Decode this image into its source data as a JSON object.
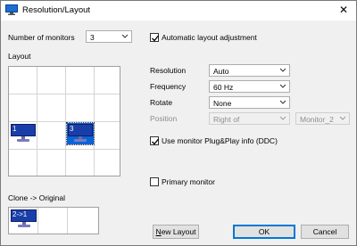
{
  "window": {
    "title": "Resolution/Layout",
    "close_glyph": "✕"
  },
  "monitors_count": {
    "label": "Number of monitors",
    "value": "3"
  },
  "auto_layout": {
    "label": "Automatic layout adjustment",
    "checked": true
  },
  "layout": {
    "label": "Layout",
    "monitors": [
      {
        "number": "1",
        "selected": false
      },
      {
        "number": "3",
        "selected": true
      }
    ]
  },
  "settings": {
    "resolution": {
      "label": "Resolution",
      "value": "Auto"
    },
    "frequency": {
      "label": "Frequency",
      "value": "60 Hz"
    },
    "rotate": {
      "label": "Rotate",
      "value": "None"
    },
    "position": {
      "label": "Position",
      "value": "Right of",
      "relative_to": "Monitor_2"
    }
  },
  "ddc": {
    "label": "Use monitor Plug&Play info (DDC)",
    "checked": true
  },
  "primary": {
    "label": "Primary monitor",
    "checked": false
  },
  "clone": {
    "label": "Clone -> Original",
    "item": "2->1"
  },
  "buttons": {
    "new_layout_prefix": "N",
    "new_layout_rest": "ew Layout",
    "ok": "OK",
    "cancel": "Cancel"
  },
  "colors": {
    "selection": "#0a64d8",
    "monitor_screen": "#1a3ea8",
    "default_border": "#0078d7"
  }
}
